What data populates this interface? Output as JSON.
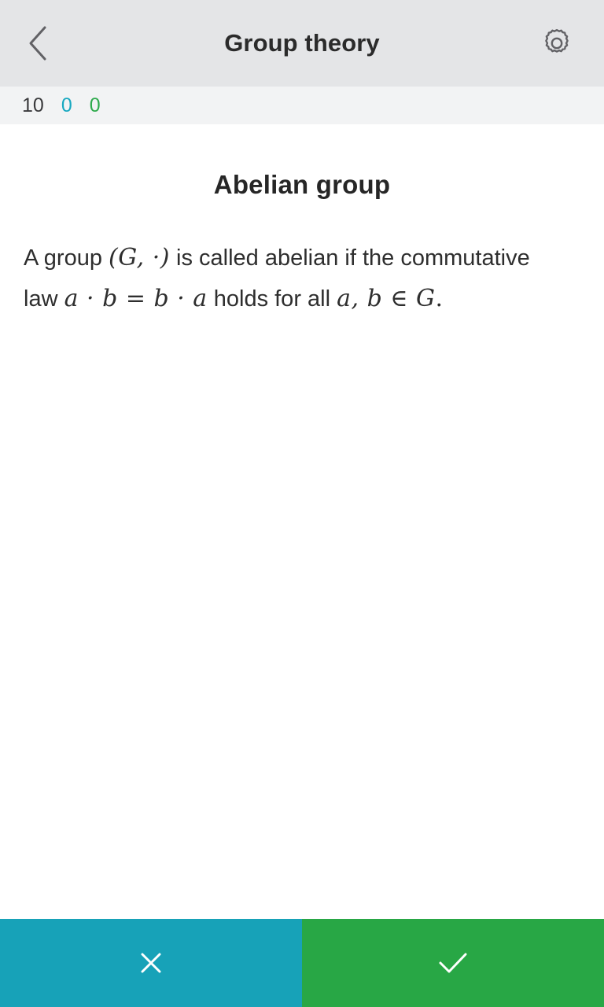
{
  "header": {
    "title": "Group theory",
    "back_icon": "chevron-left-icon",
    "settings_icon": "gear-icon"
  },
  "counters": {
    "remaining": "10",
    "wrong": "0",
    "correct": "0",
    "remaining_color": "#3a3a3c",
    "wrong_color": "#17a8c0",
    "correct_color": "#2eaa4c"
  },
  "card": {
    "title": "Abelian group",
    "text_parts": {
      "p1": "A group ",
      "m1": "(G, ·)",
      "p2": " is called abelian if the commutative law ",
      "m2": "a · b = b · a",
      "p3": " holds for all ",
      "m3": "a, b ∈ G",
      "p4": "."
    },
    "plain_text": "A group (G, ·) is called abelian if the commutative law a · b = b · a holds for all a, b ∈ G."
  },
  "actions": {
    "wrong": {
      "icon": "close-icon",
      "label": "",
      "color": "#17a2b8"
    },
    "correct": {
      "icon": "check-icon",
      "label": "",
      "color": "#28a745"
    }
  }
}
